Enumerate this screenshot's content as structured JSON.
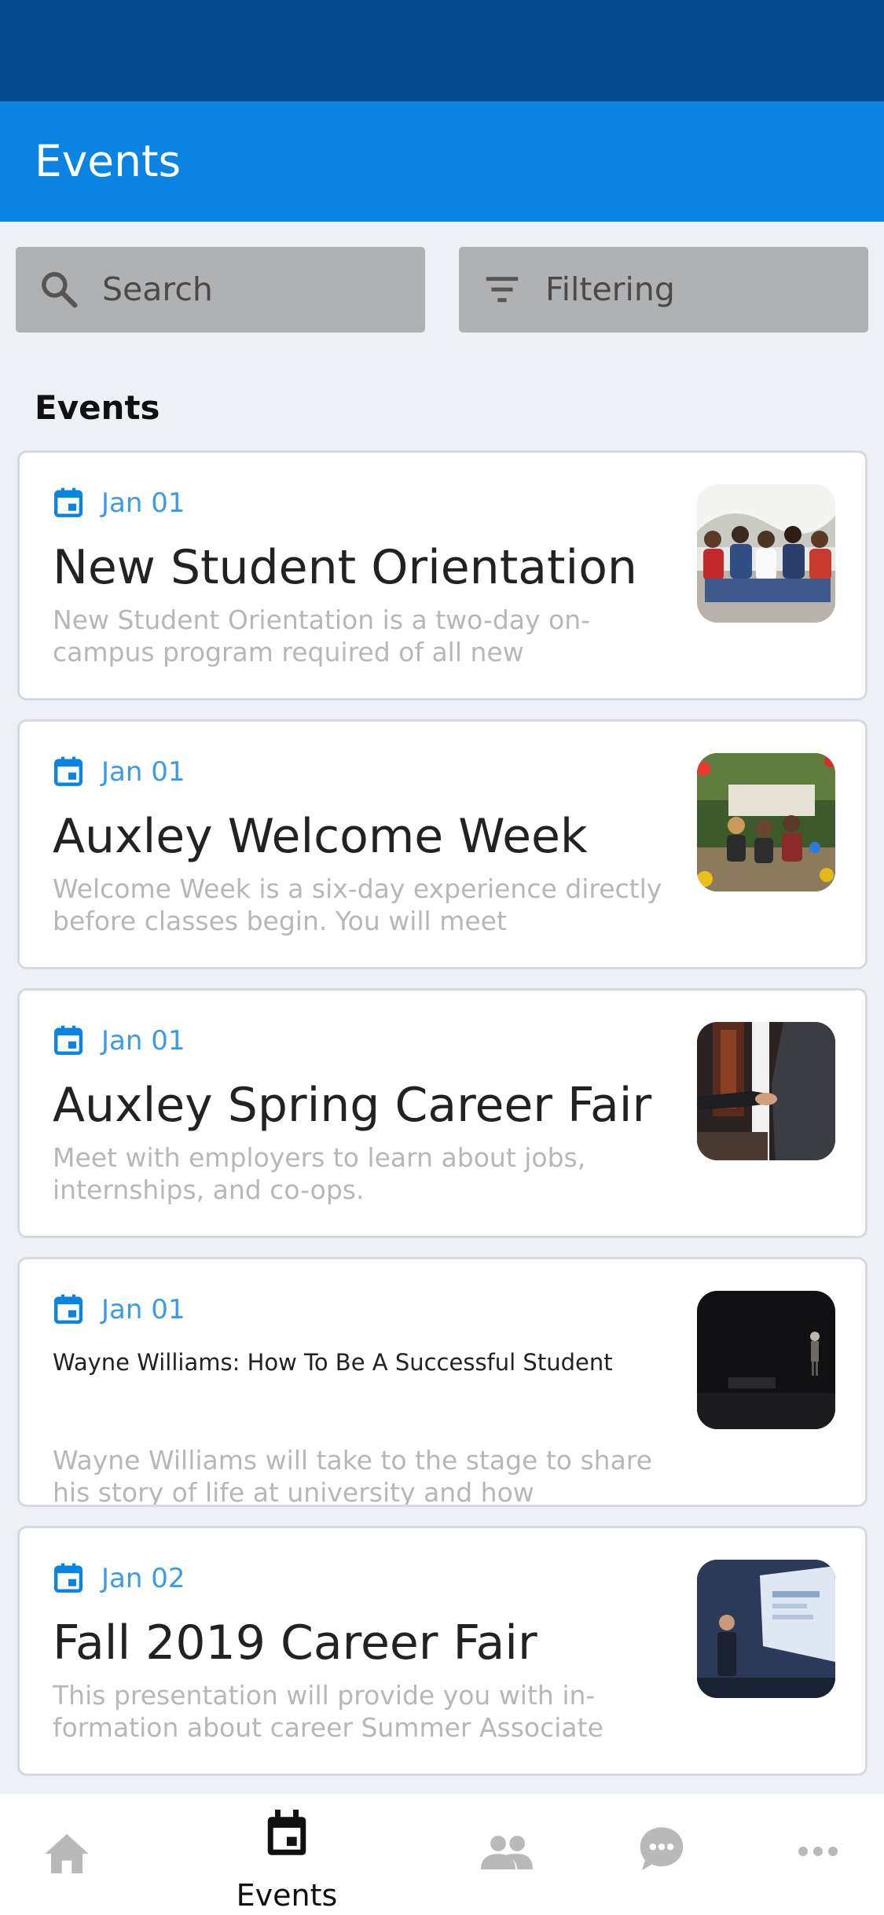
{
  "header": {
    "title": "Events"
  },
  "toolbar": {
    "search_label": "Search",
    "filter_label": "Filtering"
  },
  "section": {
    "title": "Events"
  },
  "events": [
    {
      "date": "Jan 01",
      "title": "New Student Orientation",
      "description": "New Student Orientation is a two-day on-campus program required of all new",
      "thumb": "students-group-photo"
    },
    {
      "date": "Jan 01",
      "title": "Auxley Welcome Week",
      "description": "Welcome Week is a six-day experience directly before classes begin. You will meet",
      "thumb": "outdoor-group-photo"
    },
    {
      "date": "Jan 01",
      "title": "Auxley Spring Career Fair",
      "description": "Meet with employers to learn about jobs, internships, and co-ops.",
      "thumb": "handshake-photo"
    },
    {
      "date": "Jan 01",
      "title": "Wayne Williams: How To Be A Successful Student",
      "description": "Wayne Williams will take to the stage to share his story of life at university and how",
      "thumb": "stage-speaker-photo"
    },
    {
      "date": "Jan 02",
      "title": "Fall 2019 Career Fair",
      "description": "This presentation will provide you with in-formation about career Summer Associate",
      "thumb": "presentation-photo"
    }
  ],
  "tabbar": {
    "items": [
      {
        "icon": "home-icon",
        "label": ""
      },
      {
        "icon": "calendar-icon",
        "label": "Events",
        "active": true
      },
      {
        "icon": "people-icon",
        "label": ""
      },
      {
        "icon": "chat-icon",
        "label": ""
      },
      {
        "icon": "more-icon",
        "label": ""
      }
    ]
  },
  "colors": {
    "status_bar": "#054b8e",
    "header": "#0a84e3",
    "accent": "#3d9ae6",
    "background": "#edf1f5"
  }
}
